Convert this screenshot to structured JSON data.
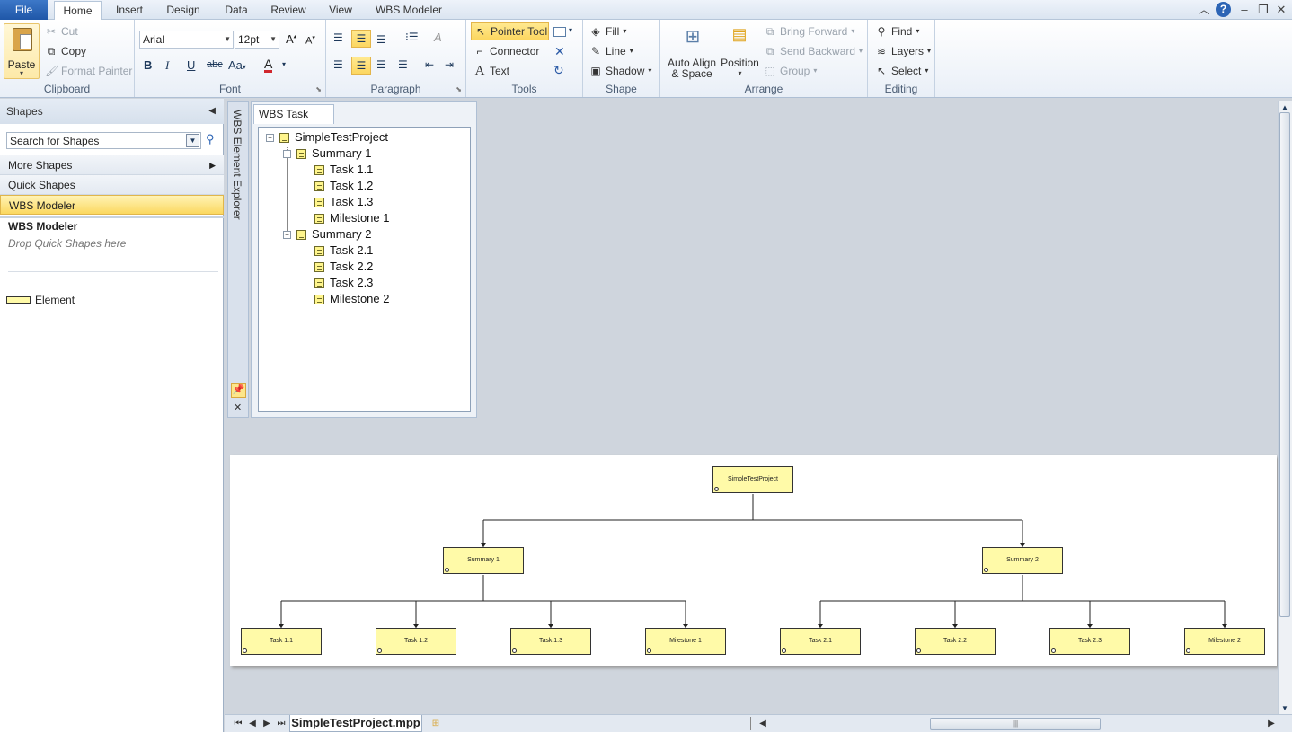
{
  "tabs": [
    {
      "label": "File"
    },
    {
      "label": "Home"
    },
    {
      "label": "Insert"
    },
    {
      "label": "Design"
    },
    {
      "label": "Data"
    },
    {
      "label": "Review"
    },
    {
      "label": "View"
    },
    {
      "label": "WBS Modeler"
    }
  ],
  "clipboard": {
    "paste": "Paste",
    "cut": "Cut",
    "copy": "Copy",
    "format_painter": "Format Painter",
    "label": "Clipboard"
  },
  "font": {
    "family": "Arial",
    "size": "12pt",
    "label": "Font"
  },
  "paragraph": {
    "label": "Paragraph"
  },
  "tools": {
    "pointer": "Pointer Tool",
    "connector": "Connector",
    "text": "Text",
    "label": "Tools"
  },
  "shape": {
    "fill": "Fill",
    "line": "Line",
    "shadow": "Shadow",
    "label": "Shape"
  },
  "arrange": {
    "auto_align": "Auto Align",
    "auto_align_2": "& Space",
    "position": "Position",
    "bring_forward": "Bring Forward",
    "send_backward": "Send Backward",
    "group": "Group",
    "label": "Arrange"
  },
  "editing": {
    "find": "Find",
    "layers": "Layers",
    "select": "Select",
    "label": "Editing"
  },
  "shapes_pane": {
    "title": "Shapes",
    "search_placeholder": "Search for Shapes",
    "more_shapes": "More Shapes",
    "quick_shapes": "Quick Shapes",
    "active_stencil": "WBS Modeler",
    "stencil_title": "WBS Modeler",
    "drop_hint": "Drop Quick Shapes here",
    "element": "Element"
  },
  "explorer": {
    "title": "WBS Element Explorer",
    "tab": "WBS Task View"
  },
  "tree": {
    "root": "SimpleTestProject",
    "summary1": "Summary 1",
    "t11": "Task 1.1",
    "t12": "Task 1.2",
    "t13": "Task 1.3",
    "m1": "Milestone 1",
    "summary2": "Summary 2",
    "t21": "Task 2.1",
    "t22": "Task 2.2",
    "t23": "Task 2.3",
    "m2": "Milestone 2"
  },
  "diagram": {
    "root": "SimpleTestProject",
    "summary1": "Summary 1",
    "summary2": "Summary 2",
    "t11": "Task 1.1",
    "t12": "Task 1.2",
    "t13": "Task 1.3",
    "m1": "Milestone 1",
    "t21": "Task 2.1",
    "t22": "Task 2.2",
    "t23": "Task 2.3",
    "m2": "Milestone 2"
  },
  "status": {
    "sheet": "SimpleTestProject.mpp"
  },
  "colors": {
    "accent": "#2c64b5",
    "selected": "#fcd760",
    "shape_fill": "#fffaa8"
  }
}
